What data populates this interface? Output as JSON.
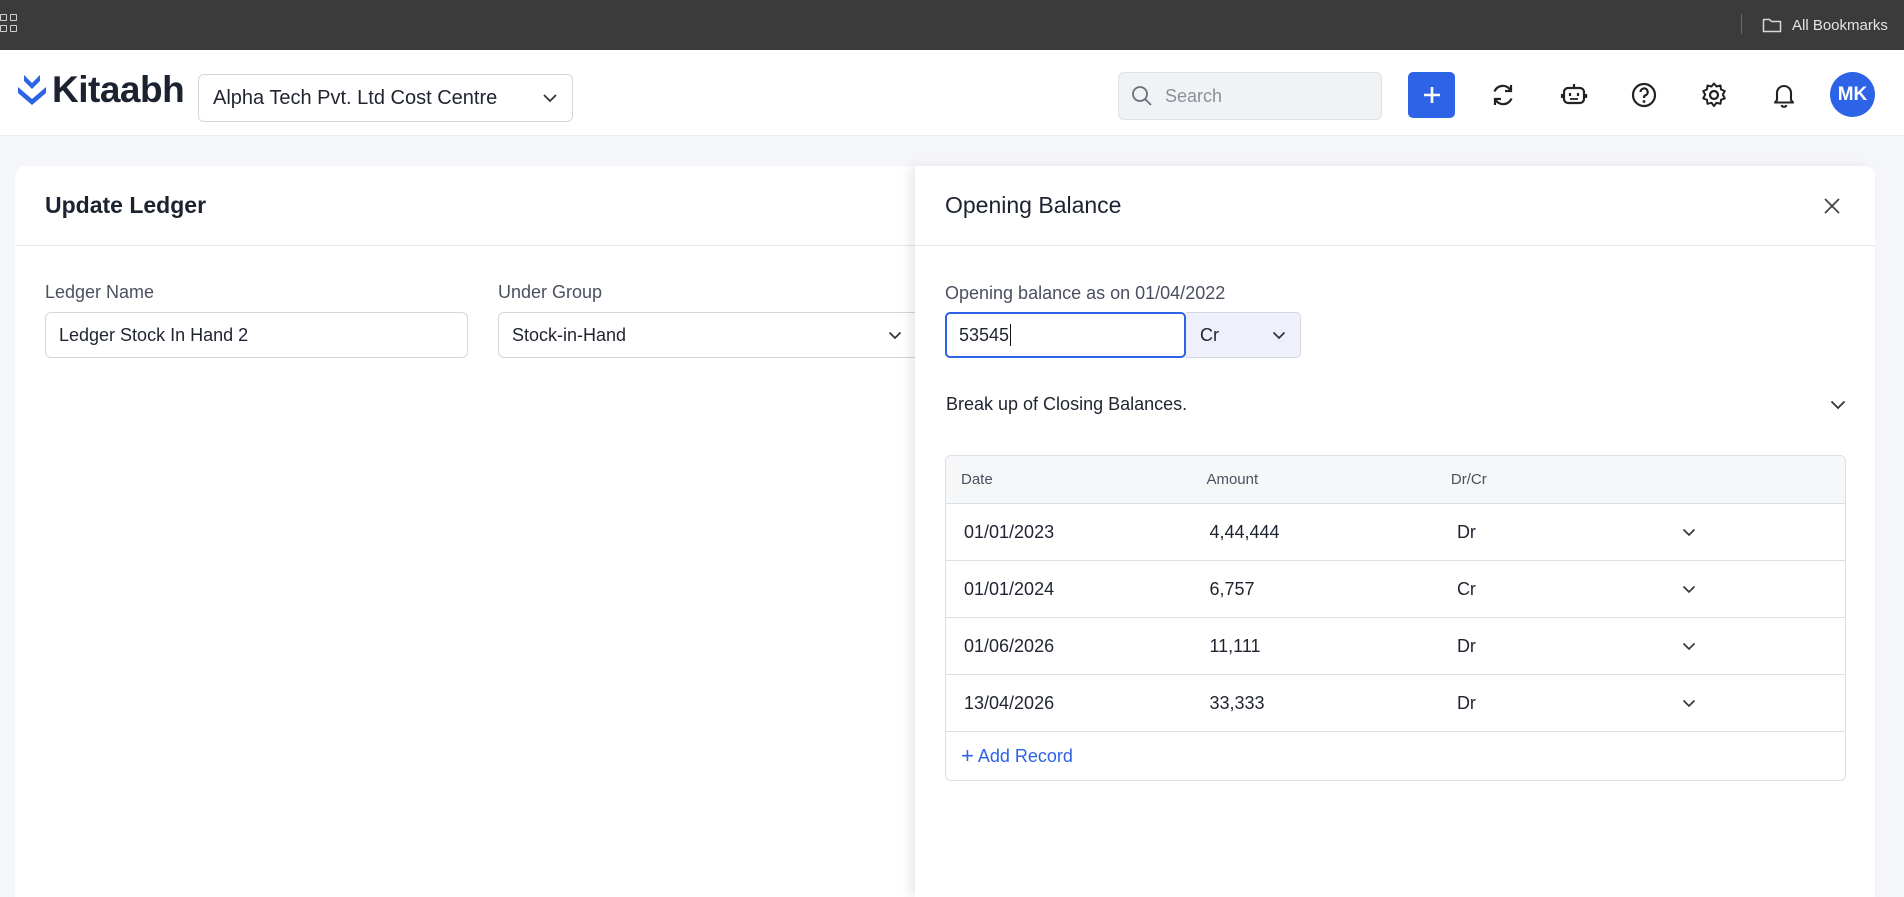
{
  "browser": {
    "bookmarks_label": "All Bookmarks"
  },
  "header": {
    "logo_text": "Kitaabh",
    "company": "Alpha Tech Pvt. Ltd Cost Centre",
    "search_placeholder": "Search",
    "avatar_initials": "MK",
    "accent_color": "#2d63e6",
    "icons": [
      "plus-icon",
      "refresh-icon",
      "bot-icon",
      "help-icon",
      "gear-icon",
      "bell-icon"
    ]
  },
  "ledger": {
    "title": "Update Ledger",
    "name_label": "Ledger Name",
    "name_value": "Ledger Stock In Hand 2",
    "group_label": "Under Group",
    "group_value": "Stock-in-Hand"
  },
  "opening_balance": {
    "title": "Opening Balance",
    "label": "Opening balance as on 01/04/2022",
    "amount": "53545",
    "type": "Cr",
    "breakup_title": "Break up of Closing Balances.",
    "columns": [
      "Date",
      "Amount",
      "Dr/Cr"
    ],
    "rows": [
      {
        "date": "01/01/2023",
        "amount": "4,44,444",
        "drcr": "Dr"
      },
      {
        "date": "01/01/2024",
        "amount": "6,757",
        "drcr": "Cr"
      },
      {
        "date": "01/06/2026",
        "amount": "11,111",
        "drcr": "Dr"
      },
      {
        "date": "13/04/2026",
        "amount": "33,333",
        "drcr": "Dr"
      }
    ],
    "add_record": "Add Record"
  }
}
